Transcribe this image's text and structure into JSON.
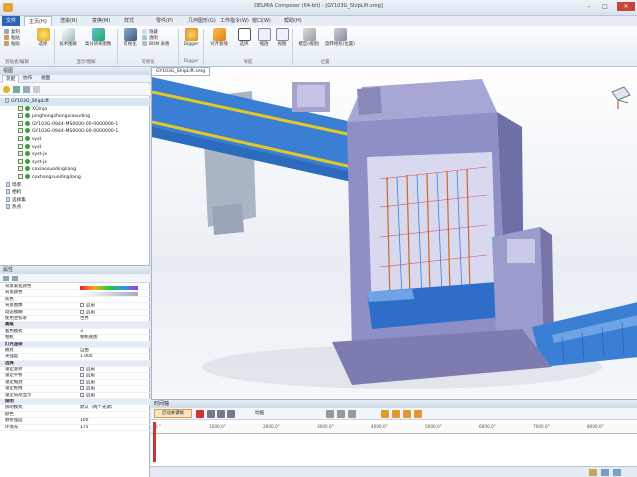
{
  "window": {
    "title": "DELMIA Composer (64-bit) - [GY103G_ShipLift.smg]"
  },
  "menu_tabs": [
    "文件",
    "主页(H)",
    "渲染(R)",
    "变换(M)",
    "样式",
    "零件(P)",
    "几何图形(G)",
    "工作指令(W)",
    "窗口(W)",
    "帮助(H)"
  ],
  "ribbon": {
    "small_left": [
      "复制",
      "粘贴",
      "粘贴"
    ],
    "buttons": [
      {
        "label": "选择"
      },
      {
        "label": "技术图解"
      },
      {
        "label": "高分辨率图像"
      },
      {
        "label": "可视化"
      },
      {
        "label": "Digger"
      },
      {
        "label": "对齐管线"
      },
      {
        "label": "选择"
      },
      {
        "label": "缩放"
      },
      {
        "label": "视图"
      },
      {
        "label": "模型(视图)"
      },
      {
        "label": "旋转相机(位置)"
      }
    ],
    "small_mid": [
      "隐藏",
      "透明",
      "BOM 表格"
    ],
    "groups": [
      "剪贴板/编辑",
      "显示/图解",
      "可视化",
      "Digger",
      "导航",
      "位置"
    ]
  },
  "tree_panel": {
    "title": "视图",
    "tabs": [
      "装配",
      "协作",
      "视图"
    ],
    "items": [
      {
        "label": "GY103G_ShipLift",
        "level": 0
      },
      {
        "label": "XQinja",
        "level": 1
      },
      {
        "label": "pinghengzhongxiaouding",
        "level": 1
      },
      {
        "label": "GY103G-0944-MS0000-00-0000000-1",
        "level": 1
      },
      {
        "label": "GY103G-0944-MS0000-00-0000000-1",
        "level": 1
      },
      {
        "label": "syst",
        "level": 1
      },
      {
        "label": "syst",
        "level": 1
      },
      {
        "label": "syst-jx",
        "level": 1
      },
      {
        "label": "syst-jx",
        "level": 1
      },
      {
        "label": "coxiaosuodingliang",
        "level": 1
      },
      {
        "label": "coxhangsuodingliang",
        "level": 1
      },
      {
        "label": "场景",
        "level": 0
      },
      {
        "label": "相机",
        "level": 0
      },
      {
        "label": "选择集",
        "level": 0
      },
      {
        "label": "热点",
        "level": 0
      }
    ]
  },
  "properties": {
    "title": "属性",
    "rows": [
      {
        "k": "背景渐变颜色",
        "v": "",
        "cat": false
      },
      {
        "k": "背景颜色",
        "v": "",
        "cat": false
      },
      {
        "k": "底色",
        "v": "",
        "cat": false
      },
      {
        "k": "背景图像",
        "v": "启用",
        "cat": false
      },
      {
        "k": "动态模糊",
        "v": "启用",
        "cat": false
      },
      {
        "k": "使用坐标系",
        "v": "世界",
        "cat": false
      },
      {
        "k": "高级",
        "v": "",
        "cat": true
      },
      {
        "k": "着色模式",
        "v": "3",
        "cat": false
      },
      {
        "k": "相机",
        "v": "相机视图",
        "cat": false
      },
      {
        "k": "灯光渲染",
        "v": "",
        "cat": true
      },
      {
        "k": "模式",
        "v": "自由",
        "cat": false
      },
      {
        "k": "光强度",
        "v": "1.000",
        "cat": false
      },
      {
        "k": "选择",
        "v": "",
        "cat": true
      },
      {
        "k": "锁定旋转",
        "v": "启用",
        "cat": false
      },
      {
        "k": "锁定平移",
        "v": "启用",
        "cat": false
      },
      {
        "k": "锁定缩放",
        "v": "启用",
        "cat": false
      },
      {
        "k": "锁定拖拽",
        "v": "启用",
        "cat": false
      },
      {
        "k": "锁定局部显示",
        "v": "启用",
        "cat": false
      },
      {
        "k": "照明",
        "v": "",
        "cat": true
      },
      {
        "k": "照明模式",
        "v": "默认（两个光源）",
        "cat": false
      },
      {
        "k": "颜色",
        "v": "",
        "cat": false
      },
      {
        "k": "散射强度",
        "v": "100",
        "cat": false
      },
      {
        "k": "环境光",
        "v": "175",
        "cat": false
      }
    ]
  },
  "document_tab": "GY103G_ShipLift.smg",
  "timeline": {
    "title": "时间轴",
    "record_label": "启动关键帧",
    "mode_label": "动画",
    "ticks": [
      "0 \"",
      "1000.0\"",
      "2000.0\"",
      "3000.0\"",
      "4000.0\"",
      "5000.0\"",
      "6000.0\"",
      "7000.0\"",
      "8000.0\"",
      "9000.0\""
    ]
  },
  "colors": {
    "accent": "#2b64b5",
    "structure": "#8f8fc8",
    "water": "#3a82d8",
    "rail": "#e2c826"
  }
}
